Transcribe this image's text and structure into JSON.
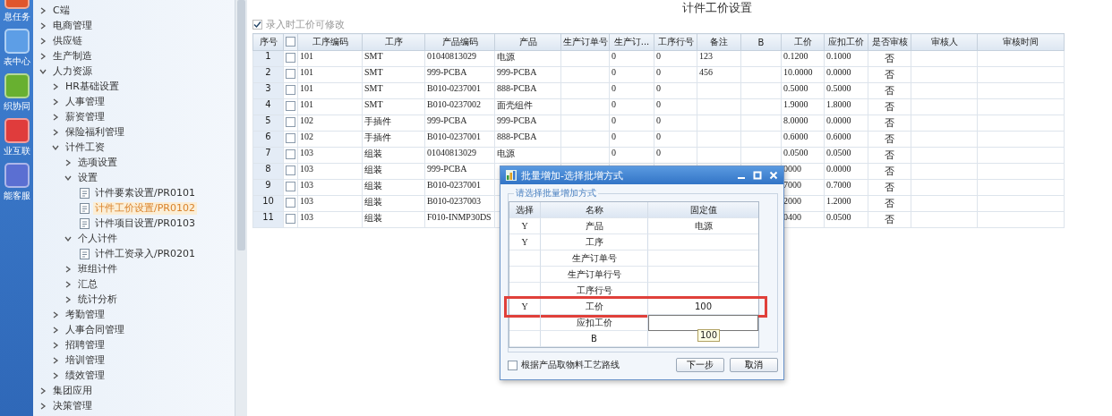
{
  "sidebar": {
    "items": [
      {
        "label": "息任务",
        "color": "#e0562c"
      },
      {
        "label": "表中心",
        "color": "#5d9ee6"
      },
      {
        "label": "织协同",
        "color": "#68b030"
      },
      {
        "label": "业互联",
        "color": "#e03c3c"
      },
      {
        "label": "能客服",
        "color": "#5b6fd2"
      }
    ]
  },
  "tree": {
    "items": [
      {
        "label": "C端",
        "kind": "folder",
        "expanded": false,
        "selected": false
      },
      {
        "label": "电商管理",
        "kind": "folder",
        "expanded": false,
        "selected": false
      },
      {
        "label": "供应链",
        "kind": "folder",
        "expanded": false,
        "selected": false
      },
      {
        "label": "生产制造",
        "kind": "folder",
        "expanded": false,
        "selected": false
      },
      {
        "label": "人力资源",
        "kind": "folder",
        "expanded": true,
        "selected": false,
        "children": [
          {
            "label": "HR基础设置",
            "kind": "folder",
            "expanded": false,
            "selected": false
          },
          {
            "label": "人事管理",
            "kind": "folder",
            "expanded": false,
            "selected": false
          },
          {
            "label": "薪资管理",
            "kind": "folder",
            "expanded": false,
            "selected": false
          },
          {
            "label": "保险福利管理",
            "kind": "folder",
            "expanded": false,
            "selected": false
          },
          {
            "label": "计件工资",
            "kind": "folder",
            "expanded": true,
            "selected": false,
            "children": [
              {
                "label": "选项设置",
                "kind": "folder",
                "expanded": false,
                "selected": false
              },
              {
                "label": "设置",
                "kind": "folder",
                "expanded": true,
                "selected": false,
                "children": [
                  {
                    "label": "计件要素设置/PR0101",
                    "kind": "page",
                    "selected": false
                  },
                  {
                    "label": "计件工价设置/PR0102",
                    "kind": "page",
                    "selected": true
                  },
                  {
                    "label": "计件项目设置/PR0103",
                    "kind": "page",
                    "selected": false
                  }
                ]
              },
              {
                "label": "个人计件",
                "kind": "folder",
                "expanded": true,
                "selected": false,
                "children": [
                  {
                    "label": "计件工资录入/PR0201",
                    "kind": "page",
                    "selected": false
                  }
                ]
              },
              {
                "label": "班组计件",
                "kind": "folder",
                "expanded": false,
                "selected": false
              },
              {
                "label": "汇总",
                "kind": "folder",
                "expanded": false,
                "selected": false
              },
              {
                "label": "统计分析",
                "kind": "folder",
                "expanded": false,
                "selected": false
              }
            ]
          },
          {
            "label": "考勤管理",
            "kind": "folder",
            "expanded": false,
            "selected": false
          },
          {
            "label": "人事合同管理",
            "kind": "folder",
            "expanded": false,
            "selected": false
          },
          {
            "label": "招聘管理",
            "kind": "folder",
            "expanded": false,
            "selected": false
          },
          {
            "label": "培训管理",
            "kind": "folder",
            "expanded": false,
            "selected": false
          },
          {
            "label": "绩效管理",
            "kind": "folder",
            "expanded": false,
            "selected": false
          }
        ]
      },
      {
        "label": "集团应用",
        "kind": "folder",
        "expanded": false,
        "selected": false
      },
      {
        "label": "决策管理",
        "kind": "folder",
        "expanded": false,
        "selected": false
      }
    ]
  },
  "page": {
    "title": "计件工价设置"
  },
  "option": {
    "label": "录入时工价可修改",
    "checked": true
  },
  "table": {
    "columns": [
      {
        "kind": "text",
        "label": "序号"
      },
      {
        "kind": "checkbox",
        "checked": false
      },
      {
        "kind": "text",
        "label": "工序编码"
      },
      {
        "kind": "text",
        "label": "工序"
      },
      {
        "kind": "text",
        "label": "产品编码"
      },
      {
        "kind": "text",
        "label": "产品"
      },
      {
        "kind": "text",
        "label": "生产订单号"
      },
      {
        "kind": "text",
        "label": "生产订..."
      },
      {
        "kind": "text",
        "label": "工序行号"
      },
      {
        "kind": "text",
        "label": "备注"
      },
      {
        "kind": "text",
        "label": "B"
      },
      {
        "kind": "text",
        "label": "工价"
      },
      {
        "kind": "text",
        "label": "应扣工价"
      },
      {
        "kind": "text",
        "label": "是否审核"
      },
      {
        "kind": "text",
        "label": "审核人"
      },
      {
        "kind": "text",
        "label": "审核时间"
      }
    ],
    "rows": [
      {
        "cells": [
          "1",
          {
            "checked": false
          },
          "101",
          "SMT",
          "01040813029",
          "电源",
          null,
          "0",
          "0",
          "123",
          null,
          "0.1200",
          "0.1000",
          "否",
          null,
          null
        ]
      },
      {
        "cells": [
          "2",
          {
            "checked": false
          },
          "101",
          "SMT",
          "999-PCBA",
          "999-PCBA",
          null,
          "0",
          "0",
          "456",
          null,
          "10.0000",
          "0.0000",
          "否",
          null,
          null
        ]
      },
      {
        "cells": [
          "3",
          {
            "checked": false
          },
          "101",
          "SMT",
          "B010-0237001",
          "888-PCBA",
          null,
          "0",
          "0",
          null,
          null,
          "0.5000",
          "0.5000",
          "否",
          null,
          null
        ]
      },
      {
        "cells": [
          "4",
          {
            "checked": false
          },
          "101",
          "SMT",
          "B010-0237002",
          "面壳组件",
          null,
          "0",
          "0",
          null,
          null,
          "1.9000",
          "1.8000",
          "否",
          null,
          null
        ]
      },
      {
        "cells": [
          "5",
          {
            "checked": false
          },
          "102",
          "手插件",
          "999-PCBA",
          "999-PCBA",
          null,
          "0",
          "0",
          null,
          null,
          "8.0000",
          "0.0000",
          "否",
          null,
          null
        ]
      },
      {
        "cells": [
          "6",
          {
            "checked": false
          },
          "102",
          "手插件",
          "B010-0237001",
          "888-PCBA",
          null,
          "0",
          "0",
          null,
          null,
          "0.6000",
          "0.6000",
          "否",
          null,
          null
        ]
      },
      {
        "cells": [
          "7",
          {
            "checked": false
          },
          "103",
          "组装",
          "01040813029",
          "电源",
          null,
          "0",
          "0",
          null,
          null,
          "0.0500",
          "0.0500",
          "否",
          null,
          null
        ]
      },
      {
        "cells": [
          "8",
          {
            "checked": false
          },
          "103",
          "组装",
          "999-PCBA",
          null,
          null,
          null,
          null,
          null,
          null,
          "0000",
          "0.0000",
          "否",
          null,
          null
        ]
      },
      {
        "cells": [
          "9",
          {
            "checked": false
          },
          "103",
          "组装",
          "B010-0237001",
          null,
          null,
          null,
          null,
          null,
          null,
          "7000",
          "0.7000",
          "否",
          null,
          null
        ]
      },
      {
        "cells": [
          "10",
          {
            "checked": false
          },
          "103",
          "组装",
          "B010-0237003",
          null,
          null,
          null,
          null,
          null,
          null,
          "2000",
          "1.2000",
          "否",
          null,
          null
        ]
      },
      {
        "cells": [
          "11",
          {
            "checked": false
          },
          "103",
          "组装",
          "F010-INMP30DS",
          null,
          null,
          null,
          null,
          null,
          null,
          "0400",
          "0.0500",
          "否",
          null,
          null
        ]
      }
    ]
  },
  "dialog": {
    "title": "批量增加-选择批增方式",
    "group": "请选择批量增加方式",
    "columns": [
      "选择",
      "名称",
      "固定值"
    ],
    "rows": [
      {
        "choice": "Y",
        "name": "产品",
        "value": "电源",
        "highlighted": false,
        "editing": false
      },
      {
        "choice": "Y",
        "name": "工序",
        "highlighted": false,
        "editing": false
      },
      {
        "name": "生产订单号",
        "highlighted": false,
        "editing": false
      },
      {
        "name": "生产订单行号",
        "highlighted": false,
        "editing": false
      },
      {
        "name": "工序行号",
        "highlighted": false,
        "editing": false
      },
      {
        "choice": "Y",
        "name": "工价",
        "value": "100",
        "highlighted": true,
        "editing": false
      },
      {
        "name": "应扣工价",
        "highlighted": false,
        "editing": true
      },
      {
        "name": "B",
        "highlighted": false,
        "editing": false
      }
    ],
    "tooltip": "100",
    "option": {
      "label": "根据产品取物料工艺路线",
      "checked": false
    },
    "buttons": [
      "下一步",
      "取消"
    ]
  }
}
